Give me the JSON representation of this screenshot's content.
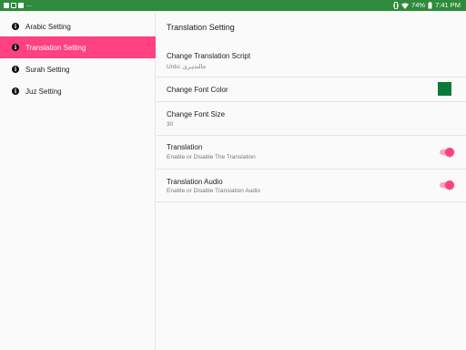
{
  "status_bar": {
    "battery": "74%",
    "time": "7:41 PM",
    "notification_overflow": "...",
    "left_icons": [
      "image-icon",
      "download-icon",
      "gallery-icon"
    ],
    "right_icons": [
      "vibrate-icon",
      "wifi-icon",
      "battery-icon"
    ]
  },
  "sidebar": {
    "items": [
      {
        "label": "Arabic Setting",
        "icon": "info-icon",
        "active": false
      },
      {
        "label": "Translation Setting",
        "icon": "info-icon",
        "active": true
      },
      {
        "label": "Surah Setting",
        "icon": "info-icon",
        "active": false
      },
      {
        "label": "Juz Setting",
        "icon": "info-icon",
        "active": false
      }
    ]
  },
  "main": {
    "title": "Translation Setting",
    "rows": [
      {
        "title": "Change Translation Script",
        "subtitle": "Urdu: جالندہری"
      },
      {
        "title": "Change Font Color",
        "swatch_color": "#0a7a3a"
      },
      {
        "title": "Change Font Size",
        "subtitle": "30"
      },
      {
        "title": "Translation",
        "subtitle": "Enable or Disable The Translation",
        "toggle_on": true
      },
      {
        "title": "Translation Audio",
        "subtitle": "Enable or Disable Translation Audio",
        "toggle_on": true
      }
    ]
  },
  "colors": {
    "status_bar": "#2e8b3c",
    "accent": "#ff4081",
    "accent_light": "#f7a6c1"
  }
}
